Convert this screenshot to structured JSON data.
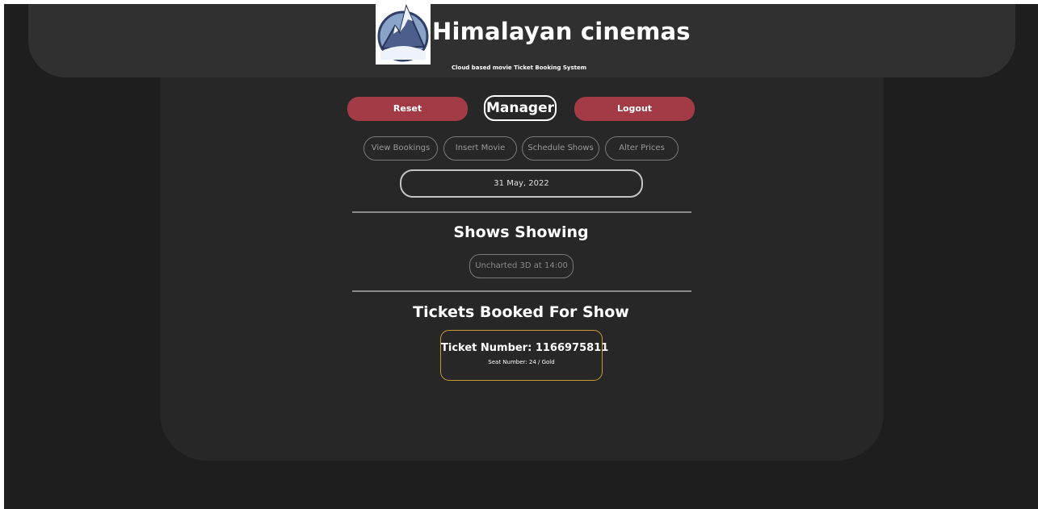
{
  "header": {
    "title": "Himalayan cinemas",
    "subtitle": "Cloud based movie Ticket Booking System"
  },
  "actions": {
    "reset_label": "Reset",
    "role_label": "Manager",
    "logout_label": "Logout"
  },
  "nav": {
    "items": [
      {
        "label": "View Bookings"
      },
      {
        "label": "Insert Movie"
      },
      {
        "label": "Schedule Shows"
      },
      {
        "label": "Alter Prices"
      }
    ]
  },
  "date": {
    "value": "31 May, 2022"
  },
  "shows": {
    "heading": "Shows Showing",
    "items": [
      {
        "label": "Uncharted 3D at 14:00"
      }
    ]
  },
  "tickets": {
    "heading": "Tickets Booked For Show",
    "items": [
      {
        "ticket_number": "Ticket Number: 1166975811",
        "seat": "Seat Number: 24 / Gold"
      }
    ]
  },
  "colors": {
    "accent_red": "#a23b45",
    "ticket_border": "#c99a2e",
    "background": "#1e1e1e",
    "panel": "#272727"
  }
}
